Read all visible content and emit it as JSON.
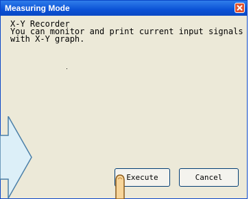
{
  "window": {
    "title": "Measuring Mode"
  },
  "content": {
    "line1": "X-Y Recorder",
    "line2": "You can monitor and print current input signals",
    "line3": "with X-Y graph."
  },
  "buttons": {
    "execute_label": "Execute",
    "cancel_label": "Cancel"
  },
  "icons": {
    "close": "close-icon",
    "arrow": "right-arrow-icon",
    "pointer": "finger-pointer-icon"
  },
  "colors": {
    "titlebar": "#0b52d6",
    "window_bg": "#ece9d8",
    "arrow_fill": "#dceff8",
    "finger_fill": "#f7d59a"
  }
}
